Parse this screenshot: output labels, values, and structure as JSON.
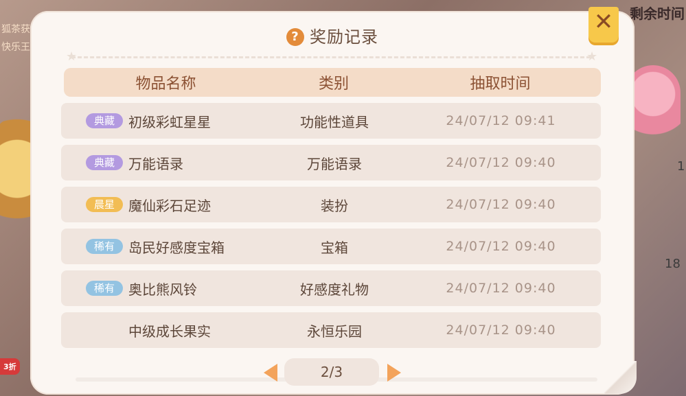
{
  "background": {
    "top_left_lines": [
      "狐茶获",
      "快乐王"
    ],
    "top_right_text": "剩余时间",
    "side_numbers": [
      "1",
      "18"
    ],
    "discount_badge": "3折"
  },
  "modal": {
    "title": "奖励记录",
    "help_icon": "?",
    "close_label": "✕"
  },
  "table": {
    "headers": {
      "name": "物品名称",
      "type": "类别",
      "time": "抽取时间"
    },
    "rows": [
      {
        "badge": "典藏",
        "badge_color": "#b39ae0",
        "name": "初级彩虹星星",
        "type": "功能性道具",
        "time": "24/07/12 09:41"
      },
      {
        "badge": "典藏",
        "badge_color": "#b39ae0",
        "name": "万能语录",
        "type": "万能语录",
        "time": "24/07/12 09:40"
      },
      {
        "badge": "晨星",
        "badge_color": "#f2bd54",
        "name": "魔仙彩石足迹",
        "type": "装扮",
        "time": "24/07/12 09:40"
      },
      {
        "badge": "稀有",
        "badge_color": "#93c3e2",
        "name": "岛民好感度宝箱",
        "type": "宝箱",
        "time": "24/07/12 09:40"
      },
      {
        "badge": "稀有",
        "badge_color": "#93c3e2",
        "name": "奥比熊风铃",
        "type": "好感度礼物",
        "time": "24/07/12 09:40"
      },
      {
        "badge": "",
        "badge_color": "",
        "name": "中级成长果实",
        "type": "永恒乐园",
        "time": "24/07/12 09:40"
      }
    ]
  },
  "pager": {
    "label": "2/3"
  }
}
